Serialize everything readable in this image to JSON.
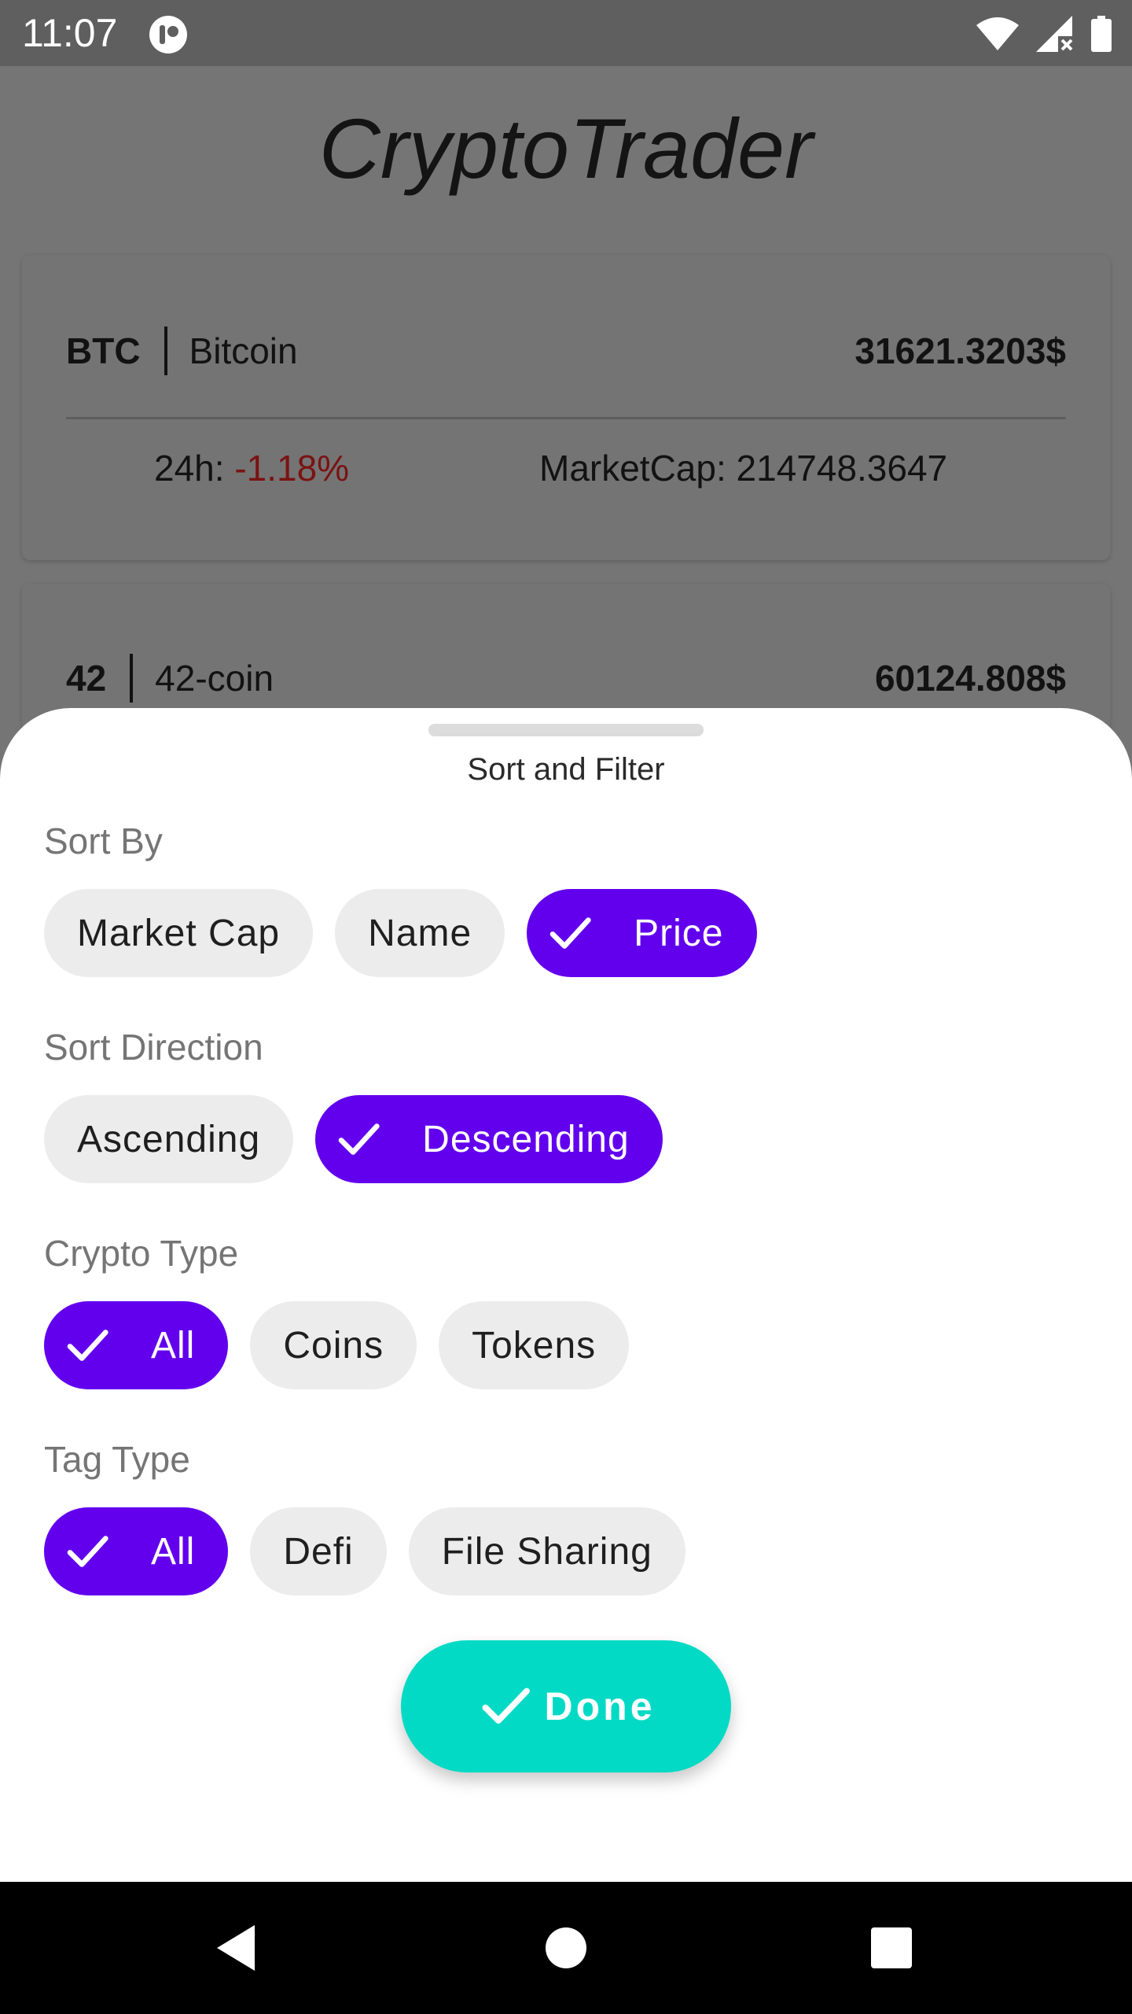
{
  "status_bar": {
    "time": "11:07",
    "icons": [
      "app-notification-icon",
      "wifi-icon",
      "cellular-no-signal-icon",
      "battery-icon"
    ]
  },
  "app": {
    "title": "CryptoTrader"
  },
  "coins": [
    {
      "symbol": "BTC",
      "name": "Bitcoin",
      "price": "31621.3203$",
      "change_label": "24h: ",
      "change_value": "-1.18%",
      "market_cap": "MarketCap: 214748.3647"
    },
    {
      "symbol": "42",
      "name": "42-coin",
      "price": "60124.808$"
    }
  ],
  "sheet": {
    "title": "Sort and Filter",
    "sections": [
      {
        "label": "Sort By",
        "chips": [
          {
            "label": "Market Cap",
            "selected": false
          },
          {
            "label": "Name",
            "selected": false
          },
          {
            "label": "Price",
            "selected": true
          }
        ]
      },
      {
        "label": "Sort Direction",
        "chips": [
          {
            "label": "Ascending",
            "selected": false
          },
          {
            "label": "Descending",
            "selected": true
          }
        ]
      },
      {
        "label": "Crypto Type",
        "chips": [
          {
            "label": "All",
            "selected": true
          },
          {
            "label": "Coins",
            "selected": false
          },
          {
            "label": "Tokens",
            "selected": false
          }
        ]
      },
      {
        "label": "Tag Type",
        "chips": [
          {
            "label": "All",
            "selected": true
          },
          {
            "label": "Defi",
            "selected": false
          },
          {
            "label": "File Sharing",
            "selected": false
          }
        ]
      }
    ],
    "done_label": "Done"
  },
  "colors": {
    "accent": "#6200ee",
    "done_button": "#03dac5",
    "negative_change": "#b71c1c",
    "chip_bg": "#ececec"
  },
  "nav_bar": {
    "icons": [
      "back-icon",
      "home-icon",
      "recents-icon"
    ]
  }
}
